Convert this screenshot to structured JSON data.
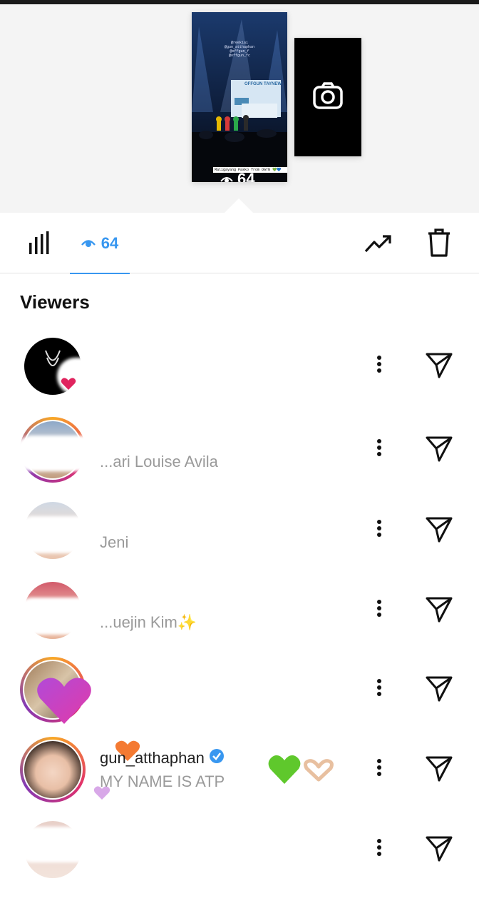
{
  "story": {
    "overlay_lines": [
      "@reekiai",
      "@gun_atthaphan",
      "@offgun_f",
      "@offgun_fc"
    ],
    "stage_text": "OFFGUN TAYNEW",
    "caption": "Maligayang Pasko from OGTN 💚💙",
    "views": "64"
  },
  "tabs": {
    "viewer_count": "64"
  },
  "section_title": "Viewers",
  "viewers": [
    {
      "username": "",
      "fullname": "",
      "avatar": "dark"
    },
    {
      "username": "",
      "fullname": "...ari Louise Avila",
      "avatar": "ring"
    },
    {
      "username": "",
      "fullname": "Jeni",
      "avatar": "plain"
    },
    {
      "username": "",
      "fullname": "...uejin Kim✨",
      "avatar": "plain"
    },
    {
      "username": "",
      "fullname": "",
      "avatar": "ring"
    },
    {
      "username": "gun_atthaphan",
      "fullname": "MY NAME IS ATP",
      "avatar": "ring",
      "verified": true
    },
    {
      "username": "",
      "fullname": "",
      "avatar": "plain"
    }
  ],
  "colors": {
    "accent": "#3897f0",
    "heart": "#e0245e"
  }
}
